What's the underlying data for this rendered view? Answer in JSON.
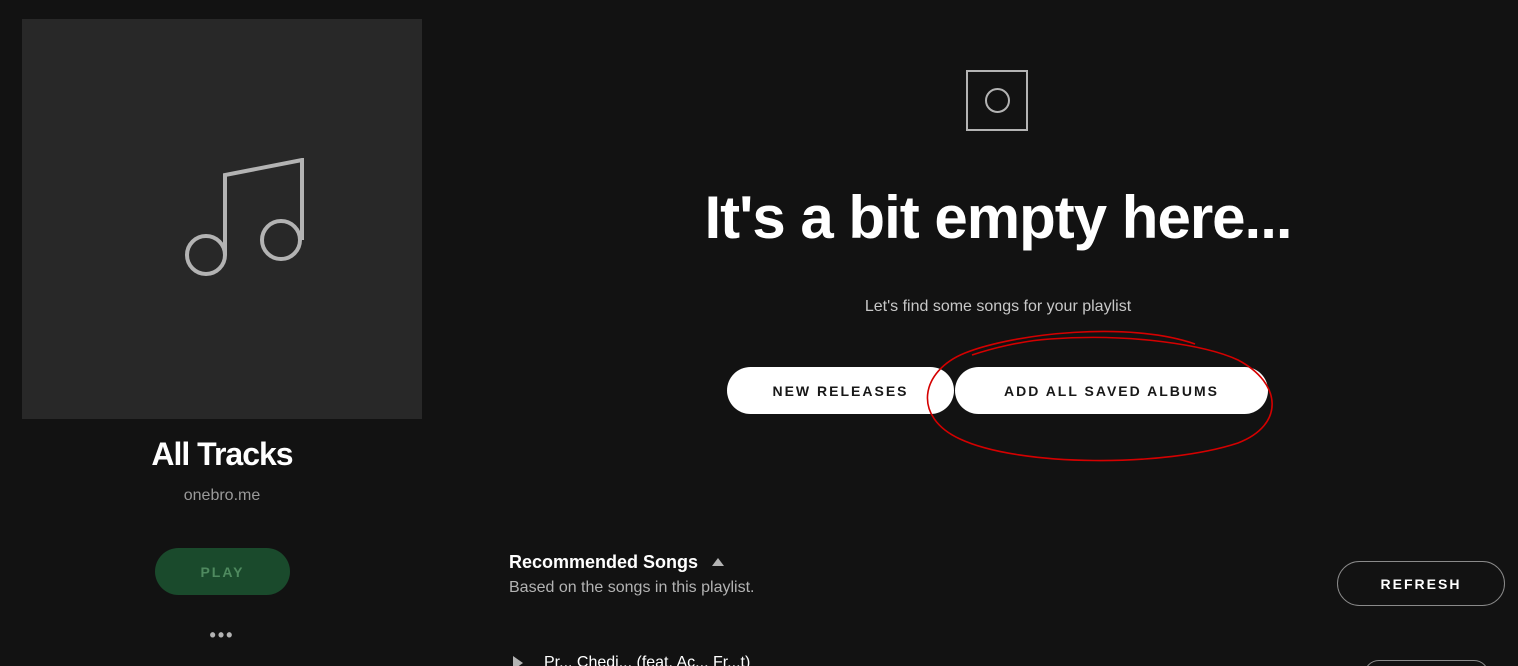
{
  "sidebar": {
    "cover_icon": "music-note-icon",
    "title": "All Tracks",
    "owner": "onebro.me",
    "play_label": "PLAY",
    "more_label": "•••"
  },
  "empty_state": {
    "icon": "empty-playlist-icon",
    "heading": "It's a bit empty here...",
    "subheading": "Let's find some songs for your playlist",
    "new_releases_label": "NEW RELEASES",
    "add_saved_albums_label": "ADD ALL SAVED ALBUMS"
  },
  "annotation": {
    "color": "#d40000"
  },
  "recommended": {
    "title": "Recommended Songs",
    "subtitle": "Based on the songs in this playlist.",
    "refresh_label": "REFRESH",
    "first_track_partial": "Pr... Chedi... (feat. Ac... Fr...t)"
  },
  "colors": {
    "background": "#121212",
    "cover": "#282828",
    "play_button": "#1a4a2c",
    "pill": "#ffffff"
  }
}
